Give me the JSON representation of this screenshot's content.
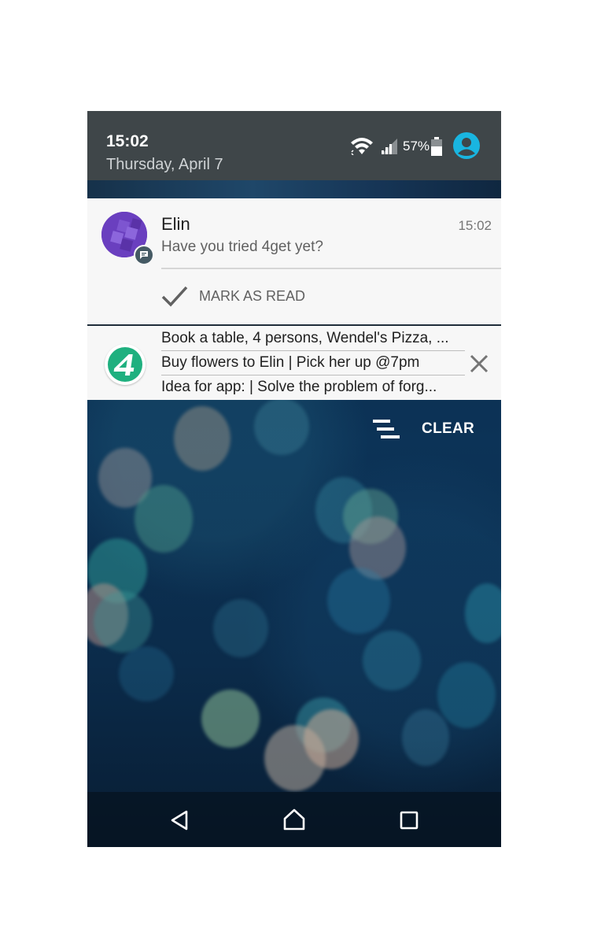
{
  "status_bar": {
    "time": "15:02",
    "date": "Thursday, April 7",
    "battery_percent": "57%",
    "icons": [
      "wifi-icon",
      "cell-signal-icon",
      "battery-icon",
      "account-icon"
    ]
  },
  "notifications": [
    {
      "sender": "Elin",
      "time": "15:02",
      "message": "Have you tried 4get yet?",
      "action_label": "MARK AS READ",
      "avatar_badge_icon": "message-icon"
    },
    {
      "app_icon": "4get-logo-icon",
      "lines": [
        "Book a table, 4 persons, Wendel's Pizza, ...",
        "Buy flowers to Elin | Pick her up @7pm",
        "Idea for app: | Solve the problem of forg..."
      ],
      "dismiss_icon": "close-icon"
    }
  ],
  "shade_actions": {
    "clear_label": "CLEAR",
    "clear_icon": "clear-all-icon"
  },
  "nav_bar": {
    "buttons": [
      "back-icon",
      "home-icon",
      "recents-icon"
    ]
  },
  "colors": {
    "status_bar_bg": "#3f4649",
    "notification_bg": "#f7f7f7",
    "account_accent": "#19b5e0",
    "app_logo_green": "#1fb07f",
    "avatar_purple": "#6a3fbf"
  }
}
